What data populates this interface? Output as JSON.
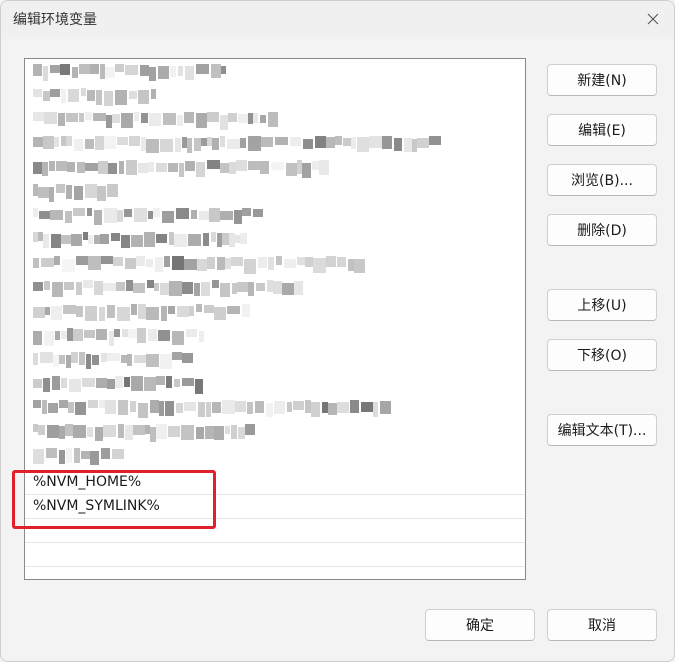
{
  "window": {
    "title": "编辑环境变量"
  },
  "list": {
    "visible_items": [
      "%NVM_HOME%",
      "%NVM_SYMLINK%"
    ]
  },
  "side_buttons": {
    "new": "新建(N)",
    "edit": "编辑(E)",
    "browse": "浏览(B)...",
    "delete": "删除(D)",
    "move_up": "上移(U)",
    "move_down": "下移(O)",
    "edit_text": "编辑文本(T)..."
  },
  "footer_buttons": {
    "ok": "确定",
    "cancel": "取消"
  },
  "colors": {
    "highlight": "#e0202a",
    "background": "#f3f3f3"
  },
  "icons": {
    "close": "close-icon"
  }
}
